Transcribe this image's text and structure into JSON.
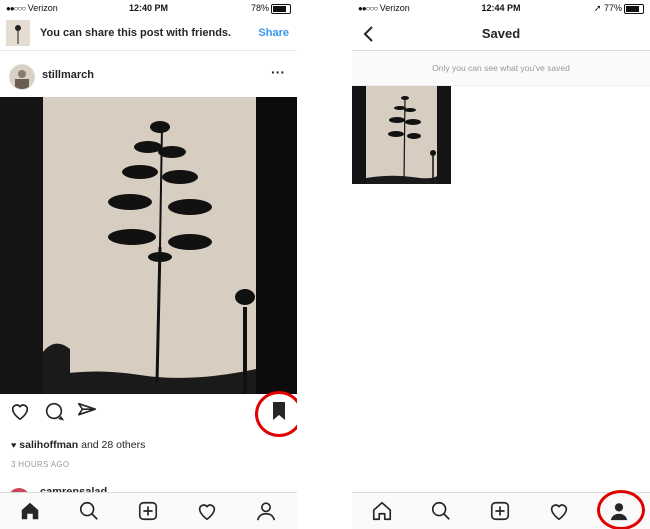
{
  "left_screen": {
    "status": {
      "carrier": "Verizon",
      "time": "12:40 PM",
      "battery": "78%",
      "battery_level": 0.78
    },
    "banner": {
      "text": "You can share this post with friends.",
      "action": "Share"
    },
    "post": {
      "username": "stillmarch",
      "likes_user": "salihoffman",
      "likes_rest": "and 28 others",
      "time_ago": "3 HOURS AGO",
      "next_username": "camrensalad"
    },
    "icons": [
      "heart-icon",
      "comment-icon",
      "send-icon",
      "bookmark-icon"
    ]
  },
  "right_screen": {
    "status": {
      "carrier": "Verizon",
      "time": "12:44 PM",
      "battery": "77%",
      "battery_level": 0.77
    },
    "title": "Saved",
    "info": "Only you can see what you've saved"
  },
  "tabbar_icons": [
    "home-icon",
    "search-icon",
    "add-icon",
    "activity-heart-icon",
    "profile-icon"
  ],
  "colors": {
    "link": "#3897f0",
    "annotation": "#e00000"
  }
}
